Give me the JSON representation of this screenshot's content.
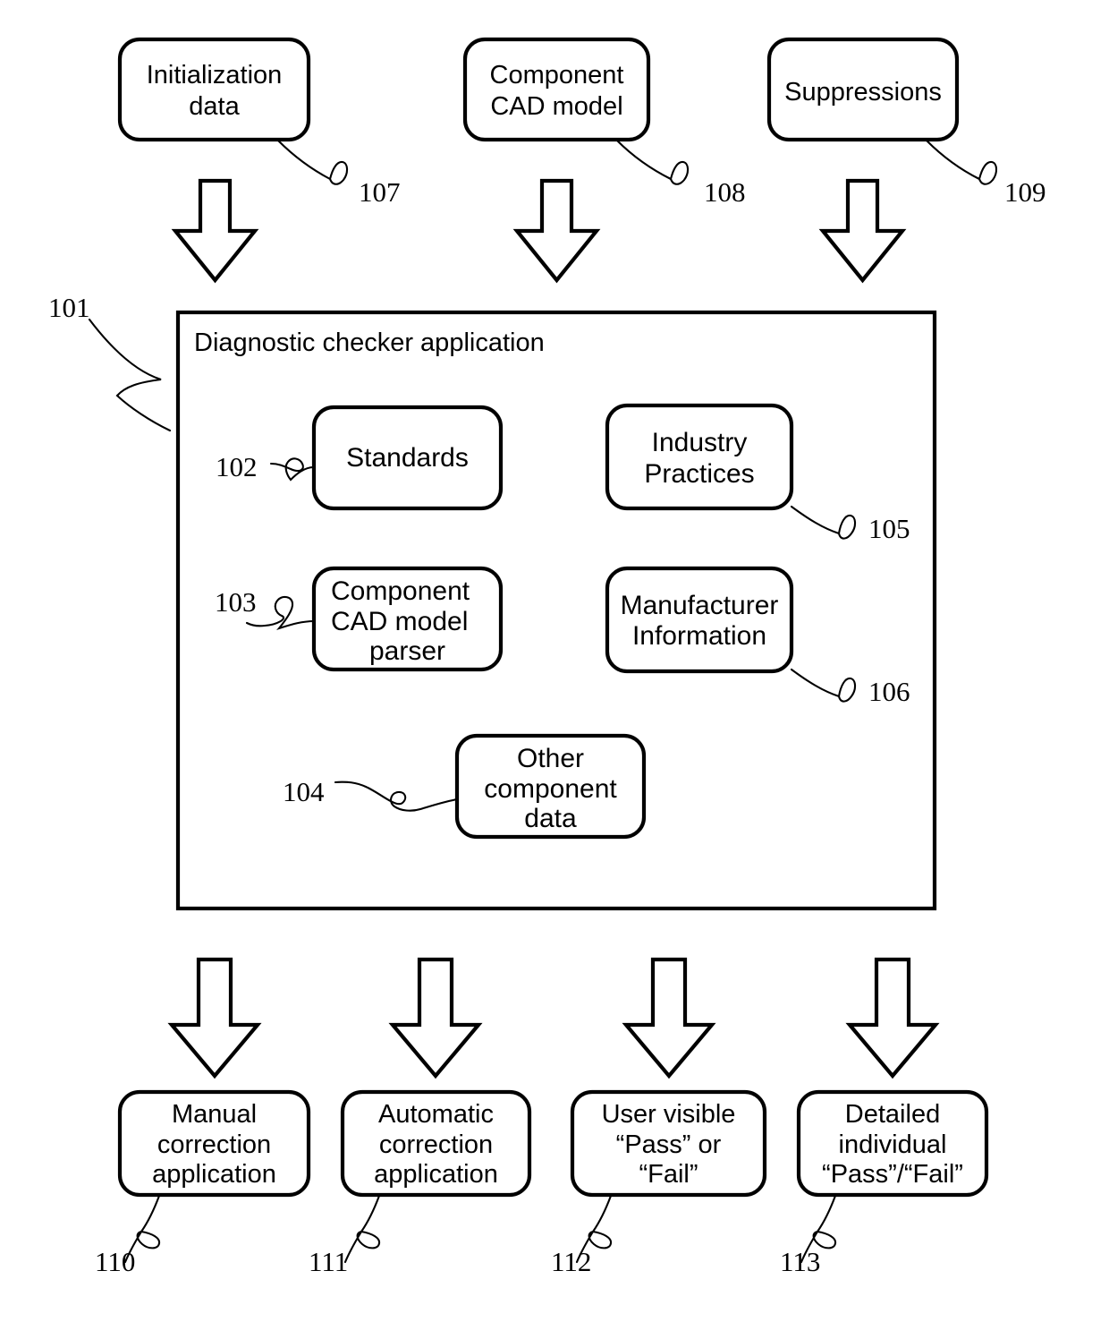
{
  "figure": {
    "title": "Diagnostic checker application block diagram",
    "background_color": "#ffffff",
    "line_color": "#000000"
  },
  "inputs": [
    {
      "ref": "107",
      "lines": [
        "Initialization",
        "data"
      ],
      "line1": "Initialization",
      "line2": "data"
    },
    {
      "ref": "108",
      "lines": [
        "Component",
        "CAD model"
      ],
      "line1": "Component",
      "line2": "CAD model"
    },
    {
      "ref": "109",
      "lines": [
        "Suppressions"
      ],
      "line1": "Suppressions",
      "line2": ""
    }
  ],
  "container": {
    "ref": "101",
    "title": "Diagnostic checker application"
  },
  "modules": [
    {
      "ref": "102",
      "line1": "Standards",
      "line2": "",
      "line3": ""
    },
    {
      "ref": "105",
      "line1": "Industry",
      "line2": "Practices",
      "line3": ""
    },
    {
      "ref": "103",
      "line1": "Component",
      "line2": "CAD model",
      "line3": "parser"
    },
    {
      "ref": "106",
      "line1": "Manufacturer",
      "line2": "Information",
      "line3": ""
    },
    {
      "ref": "104",
      "line1": "Other",
      "line2": "component",
      "line3": "data"
    }
  ],
  "outputs": [
    {
      "ref": "110",
      "line1": "Manual",
      "line2": "correction",
      "line3": "application"
    },
    {
      "ref": "111",
      "line1": "Automatic",
      "line2": "correction",
      "line3": "application"
    },
    {
      "ref": "112",
      "line1": "User visible",
      "line2": "“Pass” or",
      "line3": "“Fail”"
    },
    {
      "ref": "113",
      "line1": "Detailed",
      "line2": "individual",
      "line3": "“Pass”/“Fail”"
    }
  ]
}
